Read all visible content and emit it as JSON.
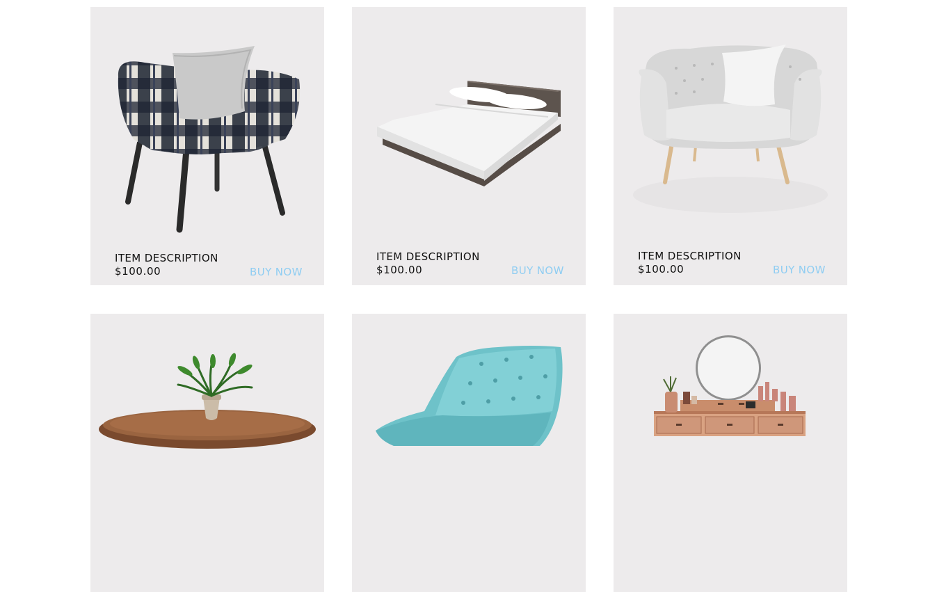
{
  "products": [
    {
      "name": "ITEM DESCRIPTION",
      "price": "$100.00",
      "cta": "BUY NOW",
      "image": "patterned-armchair"
    },
    {
      "name": "ITEM DESCRIPTION",
      "price": "$100.00",
      "cta": "BUY NOW",
      "image": "platform-bed"
    },
    {
      "name": "ITEM DESCRIPTION",
      "price": "$100.00",
      "cta": "BUY NOW",
      "image": "tufted-armchair"
    },
    {
      "image": "round-table-with-plant"
    },
    {
      "image": "teal-tufted-lounge-chair"
    },
    {
      "image": "vanity-dresser-with-mirror"
    }
  ]
}
